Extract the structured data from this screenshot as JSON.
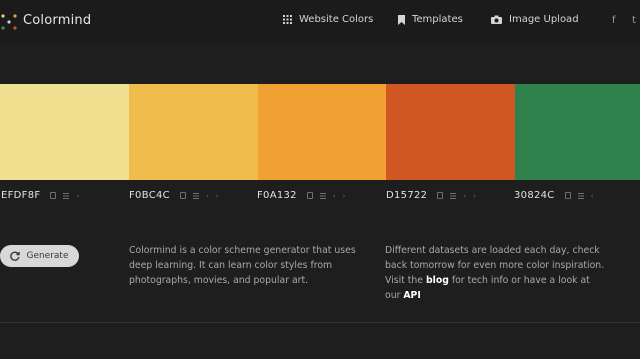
{
  "header": {
    "brand": "Colormind",
    "nav": [
      {
        "label": "Website Colors",
        "icon": "grid-icon"
      },
      {
        "label": "Templates",
        "icon": "bookmark-icon"
      },
      {
        "label": "Image Upload",
        "icon": "camera-icon"
      }
    ],
    "social": [
      {
        "label": "f",
        "icon": "facebook-icon"
      },
      {
        "label": "t",
        "icon": "twitter-icon"
      }
    ]
  },
  "palette": [
    {
      "hex": "EFDF8F",
      "color": "#EFDF8F"
    },
    {
      "hex": "F0BC4C",
      "color": "#F0BC4C"
    },
    {
      "hex": "F0A132",
      "color": "#F0A132"
    },
    {
      "hex": "D15722",
      "color": "#D15722"
    },
    {
      "hex": "30824C",
      "color": "#30824C"
    }
  ],
  "generate_label": "Generate",
  "description_left": "Colormind is a color scheme generator that uses deep learning. It can learn color styles from photographs, movies, and popular art.",
  "description_right": {
    "text_before": "Different datasets are loaded each day, check back tomorrow for even more color inspiration. Visit the ",
    "blog_link": "blog",
    "text_middle": " for tech info or have a look at our ",
    "api_link": "API"
  }
}
